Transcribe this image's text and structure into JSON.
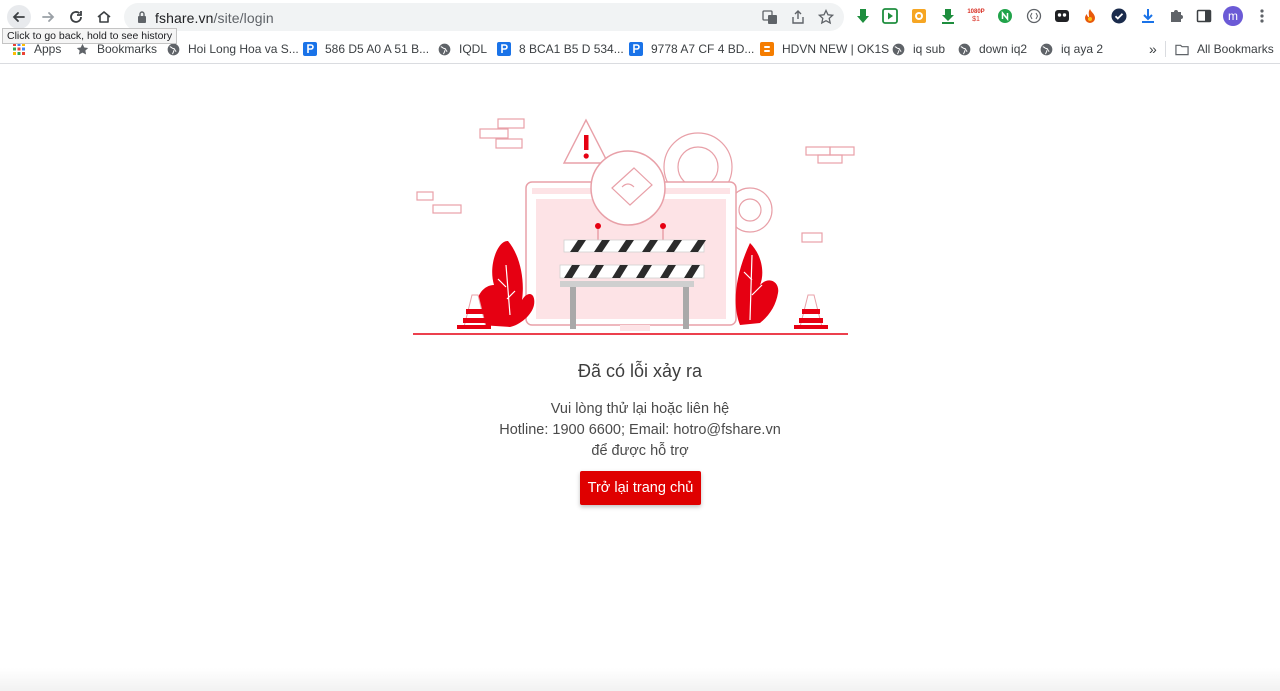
{
  "browser": {
    "url_host": "fshare.vn",
    "url_path": "/site/login",
    "tooltip": "Click to go back, hold to see history",
    "avatar_letter": "m",
    "extension_icons": [
      "download-green-icon",
      "play-green-icon",
      "box-orange-icon",
      "download-green-2-icon",
      "1080p-icon",
      "n-green-icon",
      "circle-outline-icon",
      "mask-icon",
      "fire-icon",
      "check-shield-icon",
      "download-blue-icon",
      "puzzle-icon",
      "side-panel-icon"
    ],
    "badge_1080": "1080P"
  },
  "bookmarks": [
    {
      "label": "Apps",
      "icon": "apps-grid-icon"
    },
    {
      "label": "Bookmarks",
      "icon": "star-icon"
    },
    {
      "label": "Hoi Long Hoa va S...",
      "icon": "globe-icon"
    },
    {
      "label": "586 D5 A0 A 51 B...",
      "icon": "p-blue-icon"
    },
    {
      "label": "IQDL",
      "icon": "globe-icon"
    },
    {
      "label": "8 BCA1 B5 D 534...",
      "icon": "p-blue-icon"
    },
    {
      "label": "9778 A7 CF 4 BD...",
      "icon": "p-blue-icon"
    },
    {
      "label": "HDVN NEW | OK1S",
      "icon": "blogger-icon"
    },
    {
      "label": "iq sub",
      "icon": "globe-icon"
    },
    {
      "label": "down iq2",
      "icon": "globe-icon"
    },
    {
      "label": "iq aya 2",
      "icon": "globe-icon"
    }
  ],
  "bookmarks_overflow": "»",
  "all_bookmarks": "All Bookmarks",
  "error": {
    "title": "Đã có lỗi xảy ra",
    "line1": "Vui lòng thử lại hoặc liên hệ",
    "line2": "Hotline: 1900 6600; Email: hotro@fshare.vn",
    "line3": "để được hỗ trợ",
    "button": "Trở lại trang chủ"
  },
  "colors": {
    "brand_red": "#df0000",
    "illustration_pink": "#fde3e6",
    "text": "#4a4a4a"
  }
}
